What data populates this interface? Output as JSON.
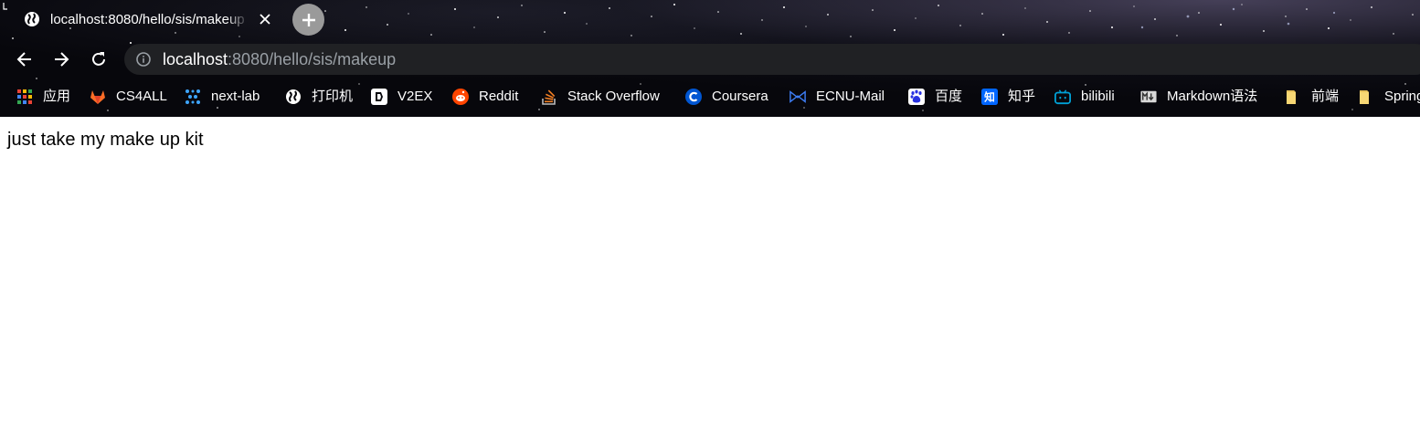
{
  "tab": {
    "title": "localhost:8080/hello/sis/makeup",
    "close_icon": "close-icon",
    "favicon": "globe-icon"
  },
  "new_tab": {
    "icon": "plus-icon"
  },
  "toolbar": {
    "back_icon": "arrow-left-icon",
    "forward_icon": "arrow-right-icon",
    "reload_icon": "reload-icon"
  },
  "address_bar": {
    "icon": "info-icon",
    "host": "localhost",
    "rest": ":8080/hello/sis/makeup"
  },
  "bookmarks": [
    {
      "label": "应用",
      "icon": "apps-grid-icon"
    },
    {
      "label": "CS4ALL",
      "icon": "gitlab-icon"
    },
    {
      "label": "next-lab",
      "icon": "dots-network-icon"
    },
    {
      "label": "打印机",
      "icon": "globe-icon"
    },
    {
      "label": "V2EX",
      "icon": "v2ex-icon"
    },
    {
      "label": "Reddit",
      "icon": "reddit-icon"
    },
    {
      "label": "Stack Overflow",
      "icon": "stackoverflow-icon"
    },
    {
      "label": "Coursera",
      "icon": "coursera-icon"
    },
    {
      "label": "ECNU-Mail",
      "icon": "mail-icon"
    },
    {
      "label": "百度",
      "icon": "baidu-paw-icon"
    },
    {
      "label": "知乎",
      "icon": "zhihu-icon"
    },
    {
      "label": "bilibili",
      "icon": "bilibili-icon"
    },
    {
      "label": "Markdown语法",
      "icon": "markdown-icon"
    },
    {
      "label": "前端",
      "icon": "folder-icon"
    },
    {
      "label": "Spring",
      "icon": "folder-icon"
    }
  ],
  "page": {
    "text": "just take my make up kit"
  },
  "colors": {
    "tab_text": "#ffffff",
    "omnibox_bg": "#202124",
    "url_host": "#ffffff",
    "url_rest": "#9aa0a6",
    "page_bg": "#ffffff",
    "page_text": "#000000"
  }
}
